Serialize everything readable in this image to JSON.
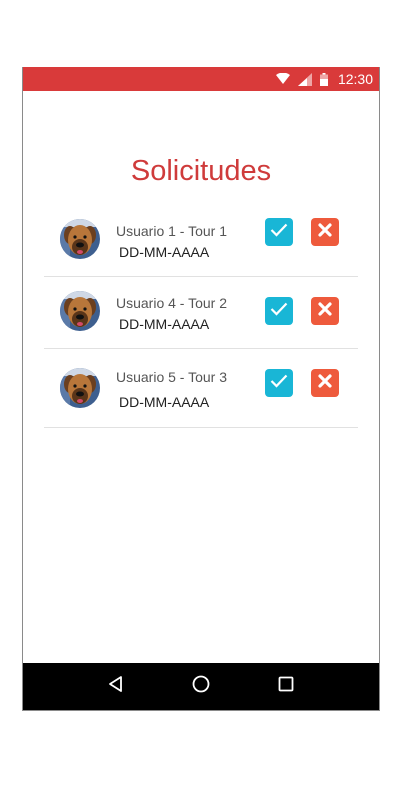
{
  "status_bar": {
    "time": "12:30",
    "color": "#d93a3a",
    "icons": [
      "wifi-icon",
      "signal-icon",
      "battery-icon"
    ]
  },
  "page": {
    "title": "Solicitudes",
    "title_color": "#cf3b3b"
  },
  "requests": [
    {
      "name": "Usuario 1 - Tour 1",
      "date": "DD-MM-AAAA",
      "avatar": "dog-avatar"
    },
    {
      "name": "Usuario 4 - Tour 2",
      "date": "DD-MM-AAAA",
      "avatar": "dog-avatar"
    },
    {
      "name": "Usuario 5 - Tour 3",
      "date": "DD-MM-AAAA",
      "avatar": "dog-avatar"
    }
  ],
  "actions": {
    "accept_icon": "check-icon",
    "accept_color": "#19b6d6",
    "reject_icon": "x-icon",
    "reject_color": "#ee5a3c"
  },
  "nav_bar": {
    "buttons": [
      "back-icon",
      "home-icon",
      "recents-icon"
    ]
  }
}
